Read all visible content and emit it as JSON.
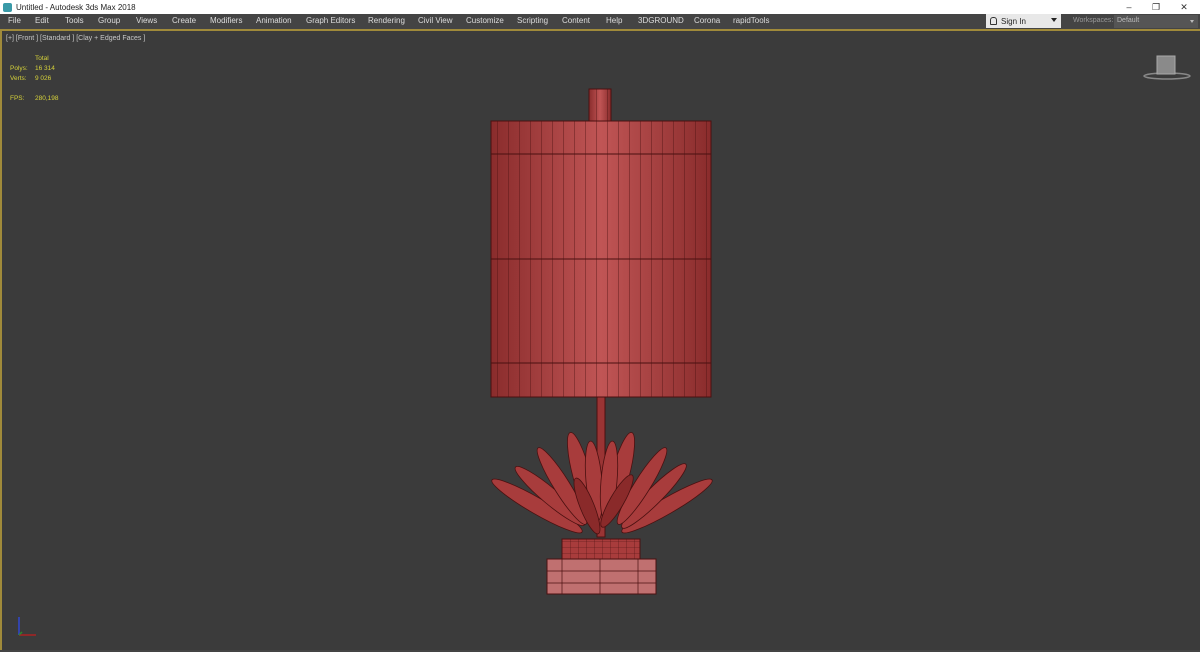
{
  "window": {
    "title": "Untitled - Autodesk 3ds Max 2018",
    "controls": [
      "–",
      "❐",
      "✕"
    ]
  },
  "menu": [
    "File",
    "Edit",
    "Tools",
    "Group",
    "Views",
    "Create",
    "Modifiers",
    "Animation",
    "Graph Editors",
    "Rendering",
    "Civil View",
    "Customize",
    "Scripting",
    "Content",
    "Help",
    "3DGROUND",
    "Corona",
    "rapidTools"
  ],
  "signin": {
    "label": "Sign In"
  },
  "workspaces": {
    "label": "Workspaces:",
    "value": "Default"
  },
  "viewport": {
    "label": "[+] [Front ] [Standard ] [Clay + Edged Faces ]",
    "stats": {
      "header": "Total",
      "polys_label": "Polys:",
      "polys": "16 314",
      "verts_label": "Verts:",
      "verts": "9 026",
      "fps_label": "FPS:",
      "fps": "280,198"
    }
  },
  "colors": {
    "viewport_bg": "#3b3b3b",
    "model": "#a83c3c",
    "stats": "#d6d23a",
    "active_border": "#a08a3a"
  }
}
